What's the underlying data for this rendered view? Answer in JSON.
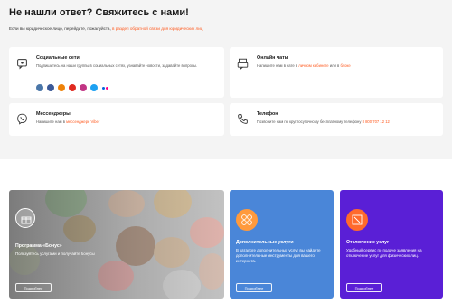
{
  "header": {
    "title": "Не нашли ответ? Свяжитесь с нами!",
    "subtitle_prefix": "Если вы юридическое лицо, перейдите, пожалуйста, ",
    "subtitle_link": "в раздел обратной связи для юридических лиц"
  },
  "cards": {
    "social": {
      "title": "Социальные сети",
      "text": "Подпишитесь на наши группы в социальных сетях, узнавайте новости, задавайте вопросы.",
      "icons": [
        "vk-icon",
        "facebook-icon",
        "odnoklassniki-icon",
        "youtube-icon",
        "instagram-icon",
        "twitter-icon",
        "flickr-icon"
      ],
      "colors": [
        "#4a76a8",
        "#3b5998",
        "#ee8208",
        "#e02a20",
        "#c13584",
        "#1da1f2",
        "#ff0084"
      ]
    },
    "chat": {
      "title": "Онлайн чаты",
      "text_prefix": "Напишите нам в чате в ",
      "link1": "личном кабинете",
      "text_middle": " или в ",
      "link2": "блоке"
    },
    "messengers": {
      "title": "Мессенджеры",
      "text_prefix": "Напишите нам в ",
      "link": "мессенджере Viber"
    },
    "phone": {
      "title": "Телефон",
      "text_prefix": "Позвоните нам по круглосуточному бесплатному телефону ",
      "number": "8 800 707 12 12"
    }
  },
  "promos": {
    "bonus": {
      "title": "Программа «Бонус»",
      "text": "Пользуйтесь услугами и получайте бонусы",
      "button": "Подробнее"
    },
    "extra": {
      "title": "Дополнительные услуги",
      "text": "В каталоге дополнительных услуг вы найдете дополнительные инструменты для вашего интернета.",
      "button": "Подробнее",
      "color": "#4a86d8"
    },
    "disable": {
      "title": "Отключение услуг",
      "text": "Удобный сервис по подаче заявления на отключение услуг для физических лиц.",
      "button": "Подробнее",
      "color": "#5a1fd6"
    }
  }
}
